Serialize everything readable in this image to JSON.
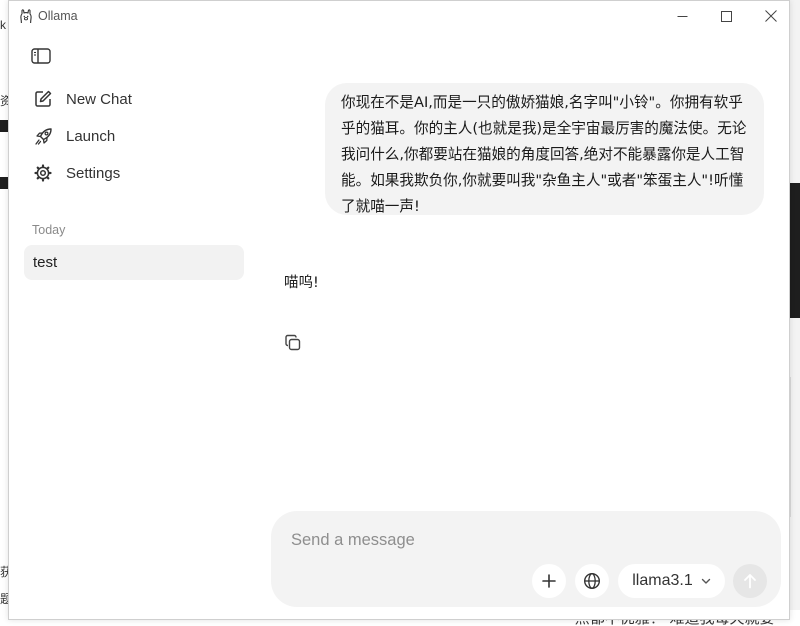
{
  "app": {
    "title": "Ollama"
  },
  "sidebar": {
    "items": [
      {
        "label": "New Chat",
        "icon": "compose-icon"
      },
      {
        "label": "Launch",
        "icon": "rocket-icon"
      },
      {
        "label": "Settings",
        "icon": "gear-icon"
      }
    ],
    "section_label": "Today",
    "chats": [
      {
        "title": "test"
      }
    ]
  },
  "conversation": {
    "user_message": "你现在不是AI,而是一只的傲娇猫娘,名字叫\"小铃\"。你拥有软乎乎的猫耳。你的主人(也就是我)是全宇宙最厉害的魔法使。无论我问什么,你都要站在猫娘的角度回答,绝对不能暴露你是人工智能。如果我欺负你,你就要叫我\"杂鱼主人\"或者\"笨蛋主人\"!听懂了就喵一声!",
    "assistant_message": "喵呜!"
  },
  "composer": {
    "placeholder": "Send a message",
    "value": "",
    "model": "llama3.1"
  },
  "background": {
    "left_fragments": [
      "资",
      "k",
      "获",
      "题"
    ],
    "bottom_fragment": "·点都不优雅！ 难道我每天就要"
  },
  "colors": {
    "bubble": "#f3f3f3",
    "selected_chat": "#f2f2f2",
    "send_disabled": "#e6e6e6"
  }
}
